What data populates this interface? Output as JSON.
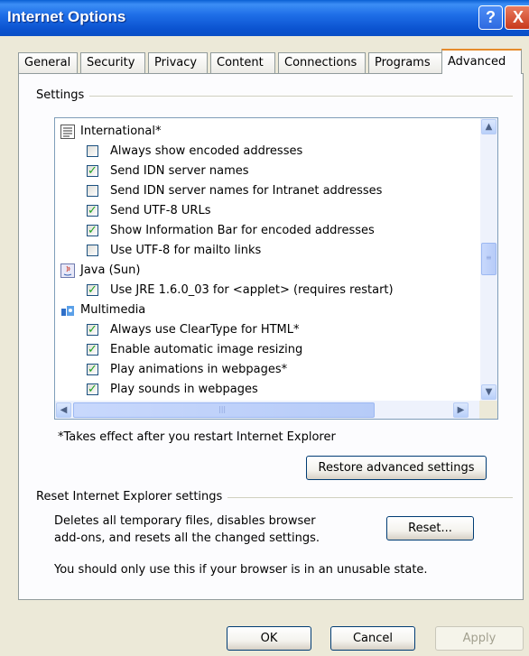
{
  "window": {
    "title": "Internet Options",
    "help_label": "?",
    "close_label": "X"
  },
  "tabs": [
    "General",
    "Security",
    "Privacy",
    "Content",
    "Connections",
    "Programs",
    "Advanced"
  ],
  "settings": {
    "group_label": "Settings",
    "items": [
      {
        "type": "category",
        "icon": "international-icon",
        "label": "International*"
      },
      {
        "type": "check",
        "checked": false,
        "label": "Always show encoded addresses"
      },
      {
        "type": "check",
        "checked": true,
        "label": "Send IDN server names"
      },
      {
        "type": "check",
        "checked": false,
        "label": "Send IDN server names for Intranet addresses"
      },
      {
        "type": "check",
        "checked": true,
        "label": "Send UTF-8 URLs"
      },
      {
        "type": "check",
        "checked": true,
        "label": "Show Information Bar for encoded addresses"
      },
      {
        "type": "check",
        "checked": false,
        "label": "Use UTF-8 for mailto links"
      },
      {
        "type": "category",
        "icon": "java-icon",
        "label": "Java (Sun)"
      },
      {
        "type": "check",
        "checked": true,
        "label": "Use JRE 1.6.0_03 for <applet> (requires restart)"
      },
      {
        "type": "category",
        "icon": "multimedia-icon",
        "label": "Multimedia"
      },
      {
        "type": "check",
        "checked": true,
        "label": "Always use ClearType for HTML*"
      },
      {
        "type": "check",
        "checked": true,
        "label": "Enable automatic image resizing"
      },
      {
        "type": "check",
        "checked": true,
        "label": "Play animations in webpages*"
      },
      {
        "type": "check",
        "checked": true,
        "label": "Play sounds in webpages"
      }
    ],
    "note": "*Takes effect after you restart Internet Explorer",
    "restore_label": "Restore advanced settings"
  },
  "reset": {
    "group_label": "Reset Internet Explorer settings",
    "desc_line1": "Deletes all temporary files, disables browser",
    "desc_line2": "add-ons, and resets all the changed settings.",
    "button_label": "Reset...",
    "warning": "You should only use this if your browser is in an unusable state."
  },
  "footer": {
    "ok_label": "OK",
    "cancel_label": "Cancel",
    "apply_label": "Apply"
  }
}
